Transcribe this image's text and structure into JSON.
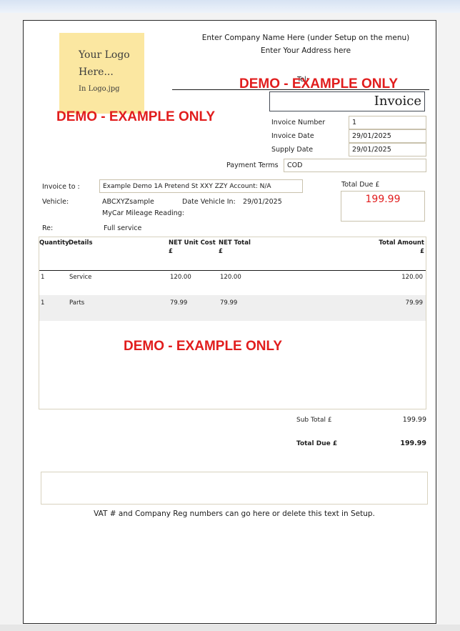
{
  "company": {
    "name": "Enter Company Name Here (under Setup on the menu)",
    "address": "Enter Your Address here",
    "tel_label": "Tel:"
  },
  "logo": {
    "line1": "Your Logo",
    "line2": "Here...",
    "line3": "In Logo.jpg"
  },
  "watermark": "DEMO - EXAMPLE ONLY",
  "invoice": {
    "title": "Invoice",
    "number_label": "Invoice Number",
    "number": "1",
    "date_label": "Invoice Date",
    "date": "29/01/2025",
    "supply_label": "Supply Date",
    "supply_date": "29/01/2025",
    "terms_label": "Payment Terms",
    "terms": "COD"
  },
  "customer": {
    "to_label": "Invoice to :",
    "to_value": "Example Demo 1A Pretend St  XXY  ZZY Account: N/A",
    "vehicle_label": "Vehicle:",
    "vehicle_value": "ABCXYZsample",
    "date_in_label": "Date Vehicle In:",
    "date_in_value": "29/01/2025",
    "mileage_label": "MyCar Mileage Reading:",
    "re_label": "Re:",
    "re_value": "Full service"
  },
  "total_due": {
    "label": "Total Due £",
    "value": "199.99"
  },
  "table": {
    "headers": {
      "quantity": "Quantity",
      "details": "Details",
      "unit_cost": "NET Unit Cost",
      "unit_cost_currency": "£",
      "net_total": "NET Total",
      "net_total_currency": "£",
      "total_amount": "Total Amount",
      "total_amount_currency": "£"
    },
    "rows": [
      {
        "quantity": "1",
        "details": "Service",
        "unit_cost": "120.00",
        "net_total": "120.00",
        "total": "120.00"
      },
      {
        "quantity": "1",
        "details": "Parts",
        "unit_cost": "79.99",
        "net_total": "79.99",
        "total": "79.99"
      }
    ]
  },
  "summary": {
    "subtotal_label": "Sub Total £",
    "subtotal": "199.99",
    "total_label": "Total Due £",
    "total": "199.99"
  },
  "footer": {
    "vat_note": "VAT # and Company Reg numbers can go here or delete this text in Setup."
  },
  "colors": {
    "demo_red": "#e11d1d",
    "logo_bg": "#fbe7a1",
    "row_shade": "#efefef"
  }
}
